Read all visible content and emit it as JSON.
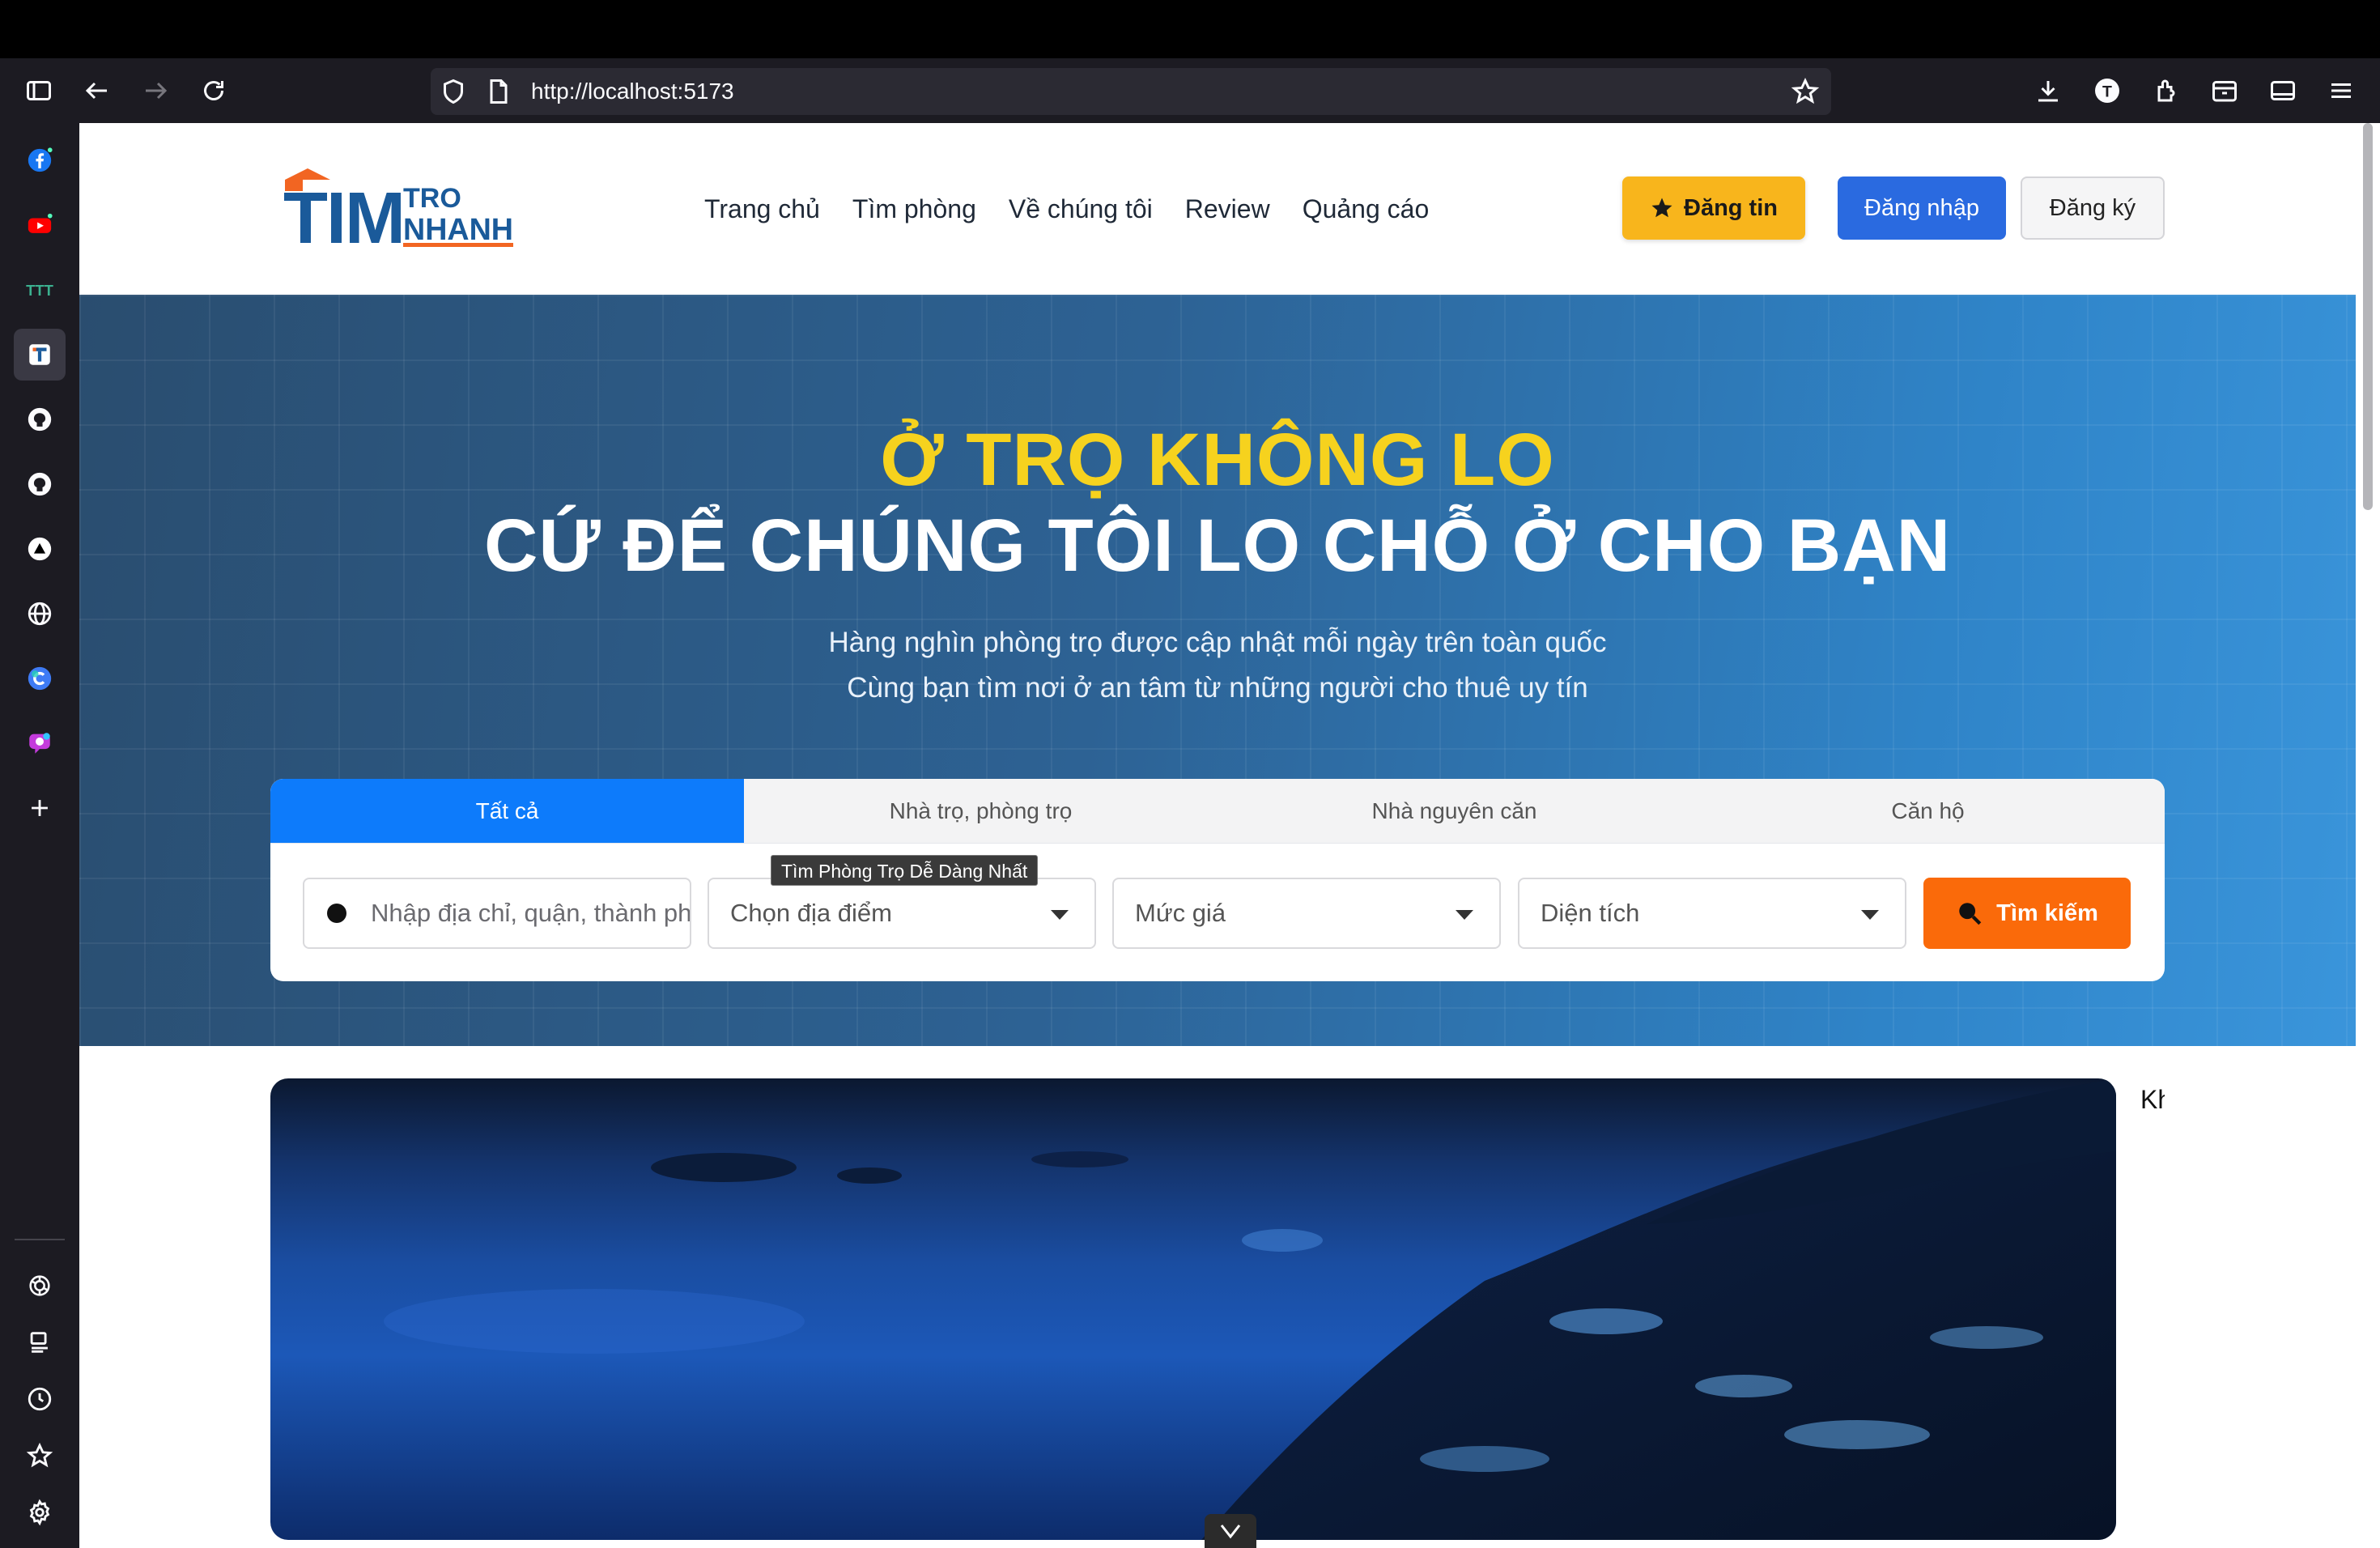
{
  "browser": {
    "url": "http://localhost:5173"
  },
  "site": {
    "logo": {
      "main": "TIM",
      "top": "TRO",
      "bottom": "NHANH"
    },
    "nav": [
      "Trang chủ",
      "Tìm phòng",
      "Về chúng tôi",
      "Review",
      "Quảng cáo"
    ],
    "post_button": "Đăng tin",
    "login_button": "Đăng nhập",
    "register_button": "Đăng ký"
  },
  "hero": {
    "title_line1": "Ở TRỌ KHÔNG LO",
    "title_line2": "CỨ ĐỂ CHÚNG TÔI LO CHỖ Ở CHO BẠN",
    "subtitle_line1": "Hàng nghìn phòng trọ được cập nhật mỗi ngày trên toàn quốc",
    "subtitle_line2": "Cùng bạn tìm nơi ở an tâm từ những người cho thuê uy tín"
  },
  "search": {
    "tabs": [
      "Tất cả",
      "Nhà trọ, phòng trọ",
      "Nhà nguyên căn",
      "Căn hộ"
    ],
    "active_tab": 0,
    "address_placeholder": "Nhập địa chỉ, quận, thành phố",
    "location_select": "Chọn địa điểm",
    "price_select": "Mức giá",
    "area_select": "Diện tích",
    "search_button": "Tìm kiếm",
    "tooltip": "Tìm Phòng Trọ Dễ Dàng Nhất"
  },
  "content": {
    "side_text": "Kh"
  },
  "colors": {
    "primary_blue": "#0d7bfb",
    "post_yellow": "#f8b51c",
    "search_orange": "#fa6a0a",
    "hero_yellow": "#f6d21e",
    "logo_blue": "#1a5a9a",
    "logo_orange": "#f26522"
  },
  "icons": {
    "sidebar": [
      "facebook-icon",
      "youtube-icon",
      "app-icon",
      "timtro-icon",
      "github-icon",
      "github-icon",
      "vercel-icon",
      "globe-icon",
      "copilot-icon",
      "chat-icon",
      "plus-icon",
      "openai-icon",
      "screenshot-icon",
      "history-icon",
      "star-icon",
      "settings-icon"
    ]
  }
}
